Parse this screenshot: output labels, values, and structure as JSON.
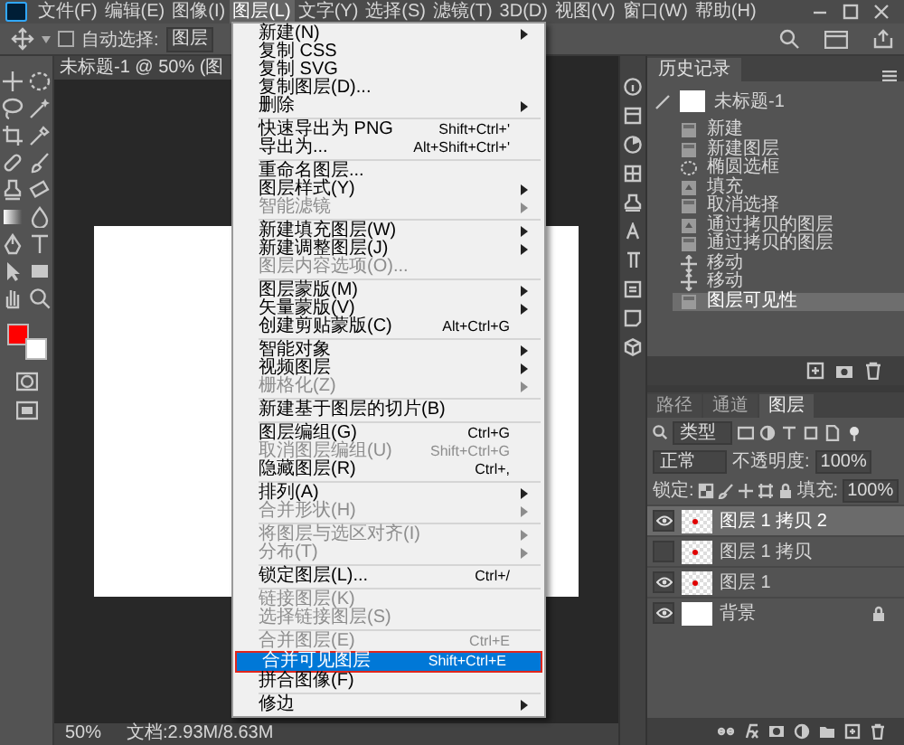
{
  "menu_bar": [
    {
      "label": "文件(F)",
      "selected": false
    },
    {
      "label": "编辑(E)",
      "selected": false
    },
    {
      "label": "图像(I)",
      "selected": false
    },
    {
      "label": "图层(L)",
      "selected": true
    },
    {
      "label": "文字(Y)",
      "selected": false
    },
    {
      "label": "选择(S)",
      "selected": false
    },
    {
      "label": "滤镜(T)",
      "selected": false
    },
    {
      "label": "3D(D)",
      "selected": false
    },
    {
      "label": "视图(V)",
      "selected": false
    },
    {
      "label": "窗口(W)",
      "selected": false
    },
    {
      "label": "帮助(H)",
      "selected": false
    }
  ],
  "options_bar": {
    "auto_select_checked": false,
    "auto_select_label": "自动选择:",
    "auto_select_value": "图层"
  },
  "document": {
    "tab_title": "未标题-1 @ 50% (图"
  },
  "tools": {
    "swatches": [
      {
        "color": "#ff0000"
      },
      {
        "color": "#ffffff"
      }
    ]
  },
  "layer_menu": {
    "items": [
      {
        "kind": "item",
        "label": "新建(N)",
        "submenu": true,
        "disabled": false,
        "selected": false,
        "outlined": false
      },
      {
        "kind": "item",
        "label": "复制 CSS",
        "submenu": false,
        "disabled": false,
        "selected": false,
        "outlined": false
      },
      {
        "kind": "item",
        "label": "复制 SVG",
        "submenu": false,
        "disabled": false,
        "selected": false,
        "outlined": false
      },
      {
        "kind": "item",
        "label": "复制图层(D)...",
        "submenu": false,
        "disabled": false,
        "selected": false,
        "outlined": false
      },
      {
        "kind": "item",
        "label": "删除",
        "submenu": true,
        "disabled": false,
        "selected": false,
        "outlined": false
      },
      {
        "kind": "separator"
      },
      {
        "kind": "item",
        "label": "快速导出为 PNG",
        "shortcut": "Shift+Ctrl+'",
        "submenu": false,
        "disabled": false,
        "selected": false,
        "outlined": false
      },
      {
        "kind": "item",
        "label": "导出为...",
        "shortcut": "Alt+Shift+Ctrl+'",
        "submenu": false,
        "disabled": false,
        "selected": false,
        "outlined": false
      },
      {
        "kind": "separator"
      },
      {
        "kind": "item",
        "label": "重命名图层...",
        "submenu": false,
        "disabled": false,
        "selected": false,
        "outlined": false
      },
      {
        "kind": "item",
        "label": "图层样式(Y)",
        "submenu": true,
        "disabled": false,
        "selected": false,
        "outlined": false
      },
      {
        "kind": "item",
        "label": "智能滤镜",
        "submenu": true,
        "disabled": true,
        "selected": false,
        "outlined": false
      },
      {
        "kind": "separator"
      },
      {
        "kind": "item",
        "label": "新建填充图层(W)",
        "submenu": true,
        "disabled": false,
        "selected": false,
        "outlined": false
      },
      {
        "kind": "item",
        "label": "新建调整图层(J)",
        "submenu": true,
        "disabled": false,
        "selected": false,
        "outlined": false
      },
      {
        "kind": "item",
        "label": "图层内容选项(O)...",
        "submenu": false,
        "disabled": true,
        "selected": false,
        "outlined": false
      },
      {
        "kind": "separator"
      },
      {
        "kind": "item",
        "label": "图层蒙版(M)",
        "submenu": true,
        "disabled": false,
        "selected": false,
        "outlined": false
      },
      {
        "kind": "item",
        "label": "矢量蒙版(V)",
        "submenu": true,
        "disabled": false,
        "selected": false,
        "outlined": false
      },
      {
        "kind": "item",
        "label": "创建剪贴蒙版(C)",
        "shortcut": "Alt+Ctrl+G",
        "submenu": false,
        "disabled": false,
        "selected": false,
        "outlined": false
      },
      {
        "kind": "separator"
      },
      {
        "kind": "item",
        "label": "智能对象",
        "submenu": true,
        "disabled": false,
        "selected": false,
        "outlined": false
      },
      {
        "kind": "item",
        "label": "视频图层",
        "submenu": true,
        "disabled": false,
        "selected": false,
        "outlined": false
      },
      {
        "kind": "item",
        "label": "栅格化(Z)",
        "submenu": true,
        "disabled": true,
        "selected": false,
        "outlined": false
      },
      {
        "kind": "separator"
      },
      {
        "kind": "item",
        "label": "新建基于图层的切片(B)",
        "submenu": false,
        "disabled": false,
        "selected": false,
        "outlined": false
      },
      {
        "kind": "separator"
      },
      {
        "kind": "item",
        "label": "图层编组(G)",
        "shortcut": "Ctrl+G",
        "submenu": false,
        "disabled": false,
        "selected": false,
        "outlined": false
      },
      {
        "kind": "item",
        "label": "取消图层编组(U)",
        "shortcut": "Shift+Ctrl+G",
        "submenu": false,
        "disabled": true,
        "selected": false,
        "outlined": false
      },
      {
        "kind": "item",
        "label": "隐藏图层(R)",
        "shortcut": "Ctrl+,",
        "submenu": false,
        "disabled": false,
        "selected": false,
        "outlined": false
      },
      {
        "kind": "separator"
      },
      {
        "kind": "item",
        "label": "排列(A)",
        "submenu": true,
        "disabled": false,
        "selected": false,
        "outlined": false
      },
      {
        "kind": "item",
        "label": "合并形状(H)",
        "submenu": true,
        "disabled": true,
        "selected": false,
        "outlined": false
      },
      {
        "kind": "separator"
      },
      {
        "kind": "item",
        "label": "将图层与选区对齐(I)",
        "submenu": true,
        "disabled": true,
        "selected": false,
        "outlined": false
      },
      {
        "kind": "item",
        "label": "分布(T)",
        "submenu": true,
        "disabled": true,
        "selected": false,
        "outlined": false
      },
      {
        "kind": "separator"
      },
      {
        "kind": "item",
        "label": "锁定图层(L)...",
        "shortcut": "Ctrl+/",
        "submenu": false,
        "disabled": false,
        "selected": false,
        "outlined": false
      },
      {
        "kind": "separator"
      },
      {
        "kind": "item",
        "label": "链接图层(K)",
        "submenu": false,
        "disabled": true,
        "selected": false,
        "outlined": false
      },
      {
        "kind": "item",
        "label": "选择链接图层(S)",
        "submenu": false,
        "disabled": true,
        "selected": false,
        "outlined": false
      },
      {
        "kind": "separator"
      },
      {
        "kind": "item",
        "label": "合并图层(E)",
        "shortcut": "Ctrl+E",
        "submenu": false,
        "disabled": true,
        "selected": false,
        "outlined": false
      },
      {
        "kind": "item",
        "label": "合并可见图层",
        "shortcut": "Shift+Ctrl+E",
        "submenu": false,
        "disabled": false,
        "selected": true,
        "outlined": true
      },
      {
        "kind": "item",
        "label": "拼合图像(F)",
        "submenu": false,
        "disabled": false,
        "selected": false,
        "outlined": false
      },
      {
        "kind": "separator"
      },
      {
        "kind": "item",
        "label": "修边",
        "submenu": true,
        "disabled": false,
        "selected": false,
        "outlined": false
      }
    ]
  },
  "history_panel": {
    "tab": "历史记录",
    "snapshot": "未标题-1",
    "items": [
      {
        "label": "新建",
        "kind": "doc",
        "selected": false
      },
      {
        "label": "新建图层",
        "kind": "doc",
        "selected": false
      },
      {
        "label": "椭圆选框",
        "kind": "marquee",
        "selected": false
      },
      {
        "label": "填充",
        "kind": "fill",
        "selected": false
      },
      {
        "label": "取消选择",
        "kind": "doc",
        "selected": false
      },
      {
        "label": "通过拷贝的图层",
        "kind": "fill",
        "selected": false
      },
      {
        "label": "通过拷贝的图层",
        "kind": "doc",
        "selected": false
      },
      {
        "label": "移动",
        "kind": "move",
        "selected": false
      },
      {
        "label": "移动",
        "kind": "move",
        "selected": false
      },
      {
        "label": "图层可见性",
        "kind": "doc",
        "selected": true
      }
    ]
  },
  "layers_panel": {
    "tabs": [
      {
        "label": "路径",
        "selected": false
      },
      {
        "label": "通道",
        "selected": false
      },
      {
        "label": "图层",
        "selected": true
      }
    ],
    "filter": "类型",
    "blend_mode": "正常",
    "opacity_label": "不透明度:",
    "opacity": "100%",
    "lock_label": "锁定:",
    "fill_label": "填充:",
    "fill": "100%",
    "layers": [
      {
        "name": "图层 1 拷贝 2",
        "kind": "pixel",
        "visible": true,
        "selected": true
      },
      {
        "name": "图层 1 拷贝",
        "kind": "pixel",
        "visible": false,
        "selected": false
      },
      {
        "name": "图层 1",
        "kind": "pixel",
        "visible": true,
        "selected": false
      },
      {
        "name": "背景",
        "kind": "background",
        "visible": true,
        "selected": false
      }
    ]
  },
  "status_bar": {
    "zoom": "50%",
    "document_size": "文档:2.93M/8.63M"
  }
}
